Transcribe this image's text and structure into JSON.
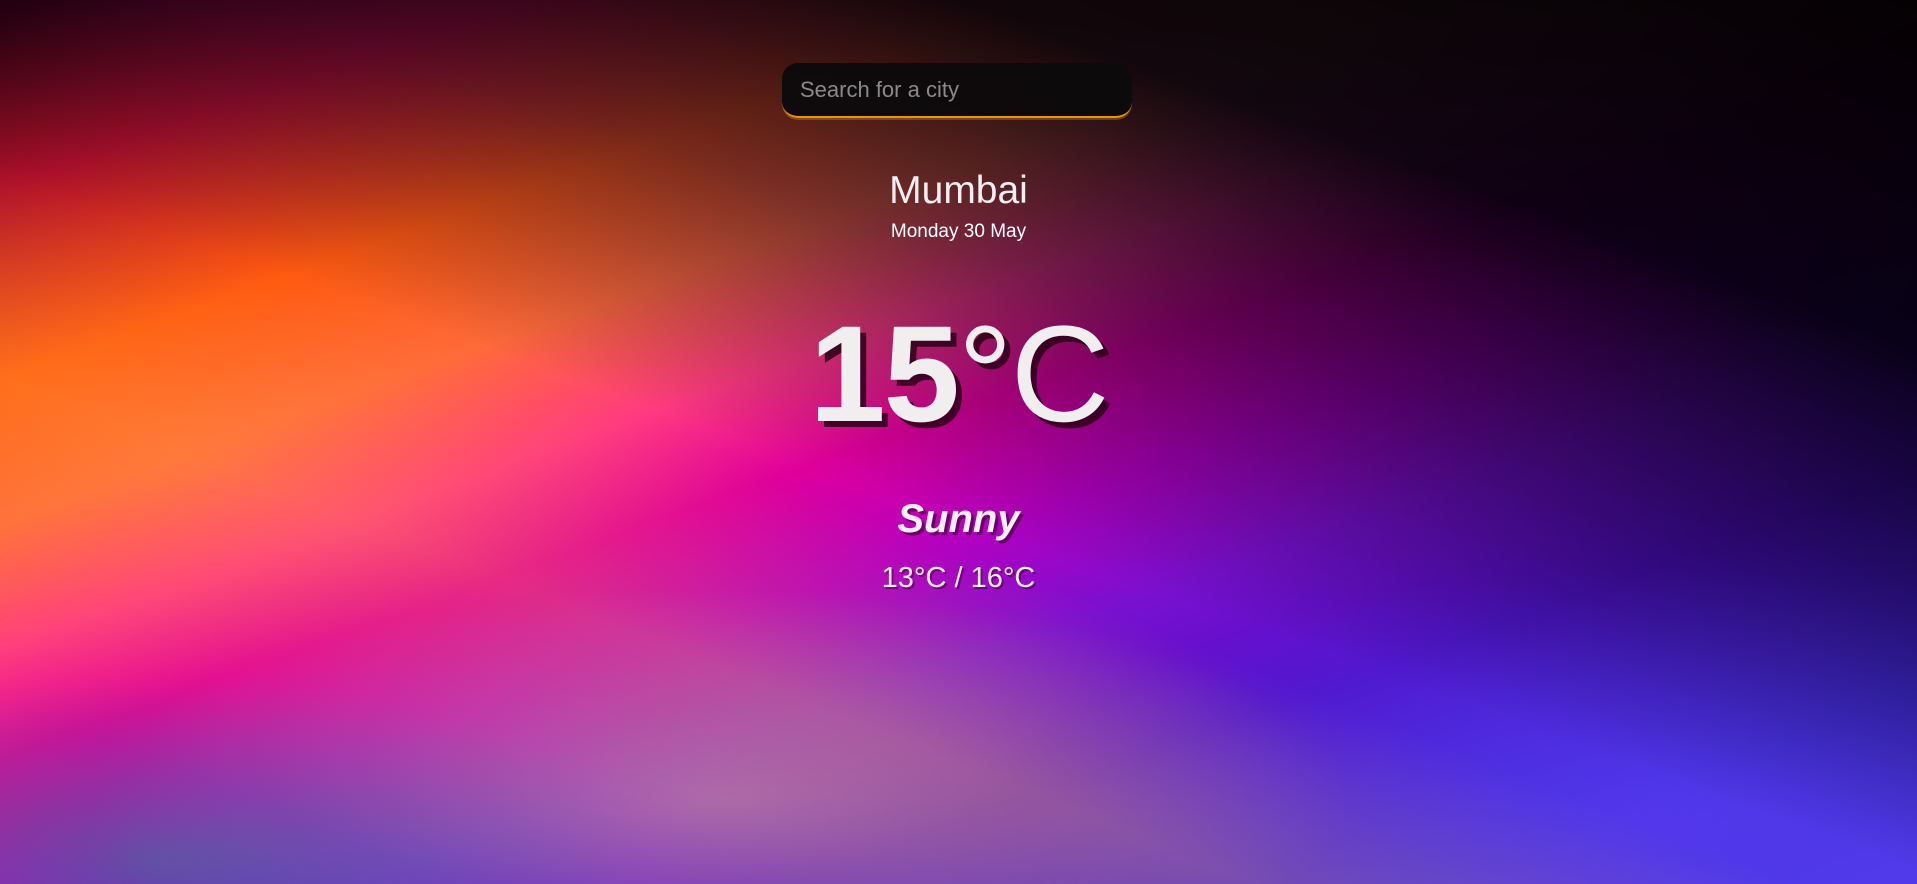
{
  "search": {
    "placeholder": "Search for a city",
    "value": ""
  },
  "weather": {
    "city": "Mumbai",
    "date": "Monday 30 May",
    "temperature_value": "15",
    "temperature_unit": "°C",
    "condition": "Sunny",
    "range": "13°C / 16°C"
  },
  "colors": {
    "search_accent": "#e8950e",
    "text": "#f2f2f2"
  }
}
